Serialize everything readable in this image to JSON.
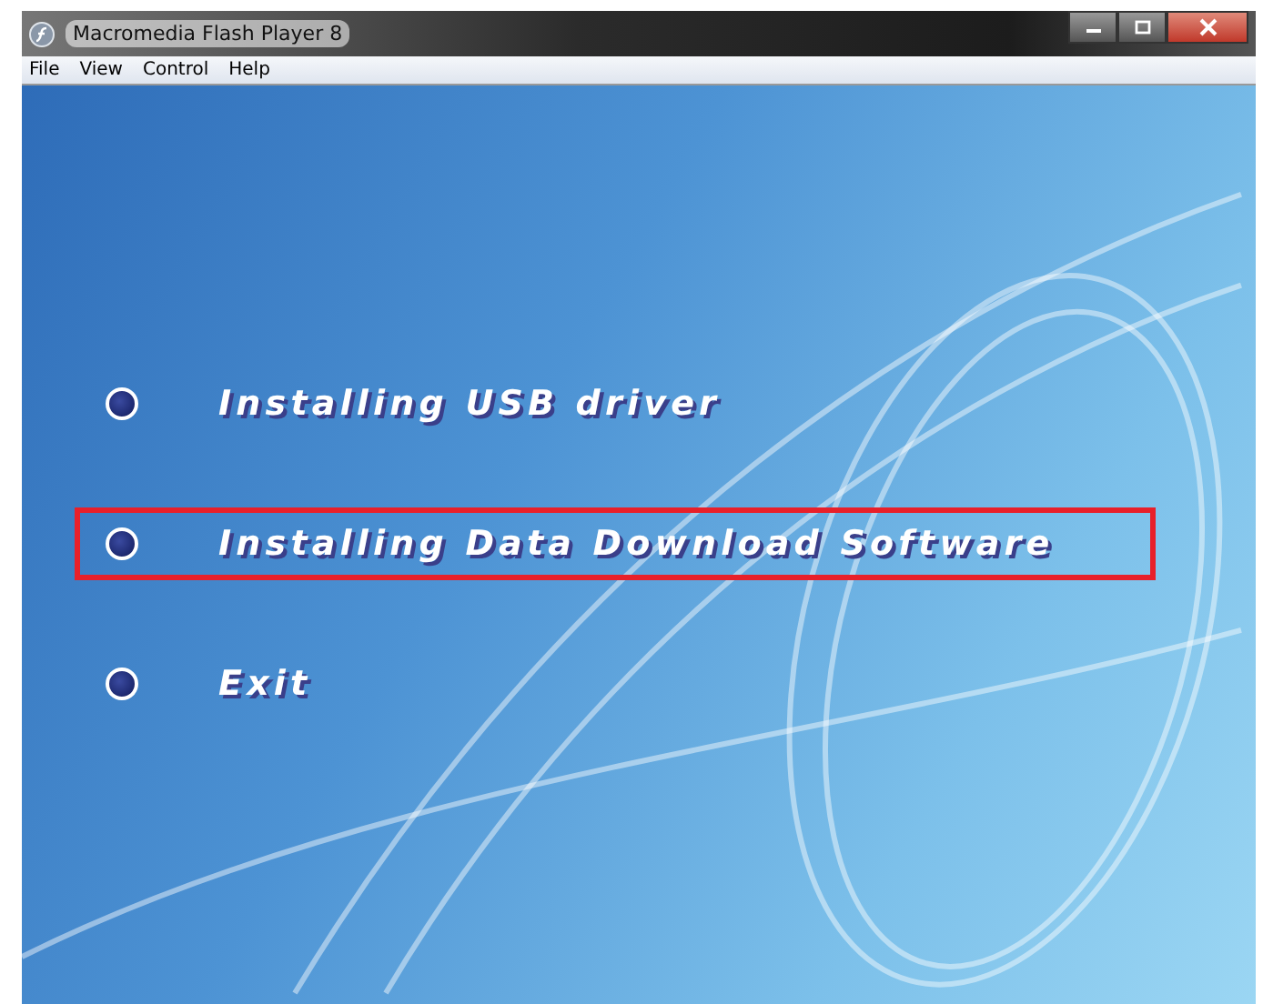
{
  "window": {
    "title": "Macromedia Flash Player 8"
  },
  "menu_bar": [
    "File",
    "View",
    "Control",
    "Help"
  ],
  "menu_options": [
    {
      "label": "Installing USB driver",
      "highlighted": false
    },
    {
      "label": "Installing Data Download Software",
      "highlighted": true
    },
    {
      "label": "Exit",
      "highlighted": false
    }
  ]
}
